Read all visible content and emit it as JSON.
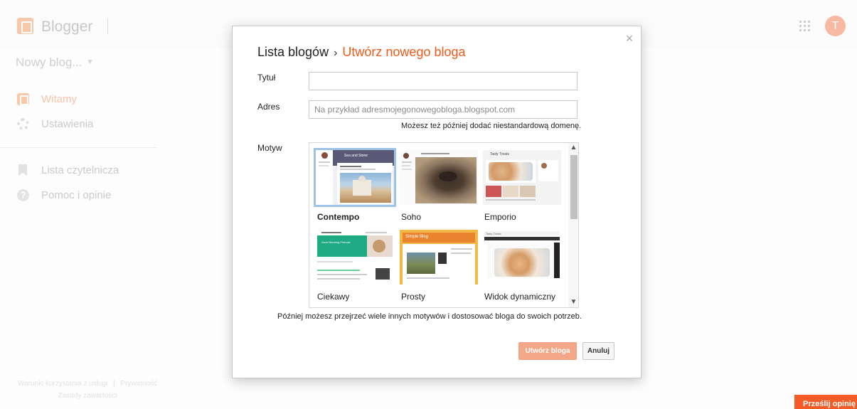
{
  "app": {
    "name": "Blogger",
    "user_initial": "T"
  },
  "sidebar": {
    "blog_select": "Nowy blog...",
    "items": [
      {
        "label": "Witamy"
      },
      {
        "label": "Ustawienia"
      },
      {
        "label": "Lista czytelnicza"
      },
      {
        "label": "Pomoc i opinie"
      }
    ],
    "footer": {
      "terms": "Warunki korzystania z usługi",
      "privacy": "Prywatność",
      "content_policy": "Zasady zawartości"
    }
  },
  "dialog": {
    "breadcrumb_parent": "Lista blogów",
    "separator": "›",
    "breadcrumb_current": "Utwórz nowego bloga",
    "close": "×",
    "title_label": "Tytuł",
    "title_value": "",
    "address_label": "Adres",
    "address_placeholder": "Na przykład adresmojegonowegobloga.blogspot.com",
    "domain_hint": "Możesz też później dodać niestandardową domenę.",
    "theme_label": "Motyw",
    "themes": [
      {
        "name": "Contempo",
        "selected": true
      },
      {
        "name": "Soho"
      },
      {
        "name": "Emporio"
      },
      {
        "name": "Ciekawy"
      },
      {
        "name": "Prosty"
      },
      {
        "name": "Widok dynamiczny"
      }
    ],
    "thumb_text": {
      "contempo": "Sea and Stone",
      "emporio": "Tasty Treats",
      "ciekawy": "Good Morning Friends!",
      "prosty": "Simple Blog",
      "dynamic": "Tasty Treats"
    },
    "scroll_up": "▲",
    "scroll_down": "▼",
    "footnote": "Później możesz przejrzeć wiele innych motywów i dostosować bloga do swoich potrzeb.",
    "create_button": "Utwórz bloga",
    "cancel_button": "Anuluj"
  },
  "feedback_button": "Prześlij opinię",
  "colors": {
    "accent": "#f05a18",
    "create_button": "#f4a788",
    "feedback": "#f35b27"
  }
}
